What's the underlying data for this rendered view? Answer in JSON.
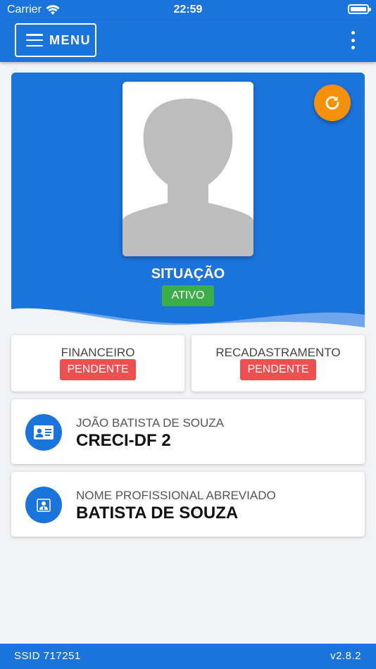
{
  "status_bar": {
    "carrier": "Carrier",
    "time": "22:59"
  },
  "app_bar": {
    "menu_label": "MENU",
    "more_icon": "more-vertical-icon"
  },
  "profile": {
    "status_heading": "SITUAÇÃO",
    "status_value": "ATIVO",
    "status_color": "#3cae47",
    "refresh_icon": "refresh-icon",
    "refresh_color": "#f5900a"
  },
  "status_cards": [
    {
      "title": "FINANCEIRO",
      "badge": "PENDENTE"
    },
    {
      "title": "RECADASTRAMENTO",
      "badge": "PENDENTE"
    }
  ],
  "info_cards": [
    {
      "icon": "id-card-icon",
      "label": "JOÃO BATISTA DE SOUZA",
      "value": "CRECI-DF 2"
    },
    {
      "icon": "person-badge-icon",
      "label": "NOME PROFISSIONAL ABREVIADO",
      "value": "BATISTA DE SOUZA"
    }
  ],
  "footer": {
    "ssid": "SSID 717251",
    "version": "v2.8.2"
  },
  "colors": {
    "primary": "#1b73dc",
    "pending": "#f04f4f",
    "background": "#f2f3f5"
  }
}
